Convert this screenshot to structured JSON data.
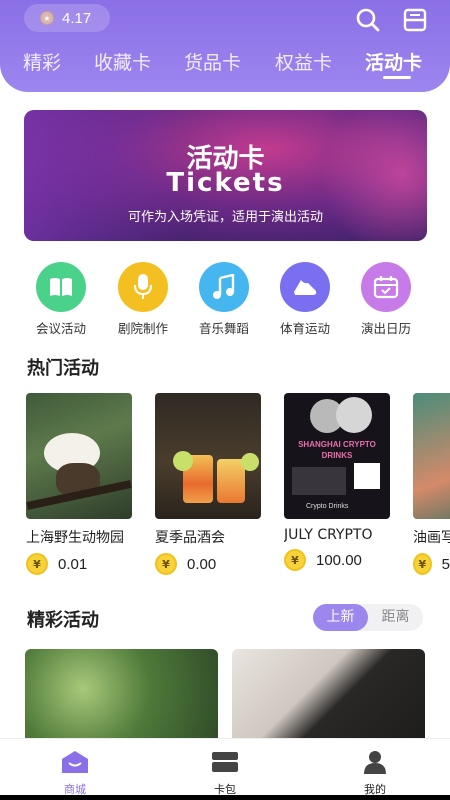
{
  "header": {
    "balance": "4.17",
    "tabs": [
      "精彩",
      "收藏卡",
      "货品卡",
      "权益卡",
      "活动卡"
    ],
    "active_tab": "活动卡"
  },
  "banner": {
    "title": "活动卡",
    "subtitle": "Tickets",
    "description": "可作为入场凭证，适用于演出活动"
  },
  "categories": [
    {
      "label": "会议活动",
      "icon": "book-icon",
      "color": "#4bd28a"
    },
    {
      "label": "剧院制作",
      "icon": "microphone-icon",
      "color": "#f4c021"
    },
    {
      "label": "音乐舞蹈",
      "icon": "music-note-icon",
      "color": "#45b6f0"
    },
    {
      "label": "体育运动",
      "icon": "sneaker-icon",
      "color": "#7a6ff0"
    },
    {
      "label": "演出日历",
      "icon": "calendar-icon",
      "color": "#c77be8"
    }
  ],
  "hot_section": {
    "title": "热门活动",
    "items": [
      {
        "name": "上海野生动物园",
        "price": "0.01"
      },
      {
        "name": "夏季品酒会",
        "price": "0.00"
      },
      {
        "name": "JULY CRYPTO",
        "price": "100.00",
        "poster_title": "SHANGHAI CRYPTO DRINKS",
        "poster_footer": "Crypto Drinks"
      },
      {
        "name": "油画写",
        "price": "5"
      }
    ]
  },
  "featured_section": {
    "title": "精彩活动",
    "toggle": [
      "上新",
      "距离"
    ],
    "active_toggle": "上新"
  },
  "bottom_nav": [
    {
      "label": "商城",
      "icon": "store-icon",
      "active": true
    },
    {
      "label": "卡包",
      "icon": "card-wallet-icon",
      "active": false
    },
    {
      "label": "我的",
      "icon": "profile-icon",
      "active": false
    }
  ],
  "colors": {
    "accent": "#8a6fe6",
    "coin": "#f8d23a"
  }
}
